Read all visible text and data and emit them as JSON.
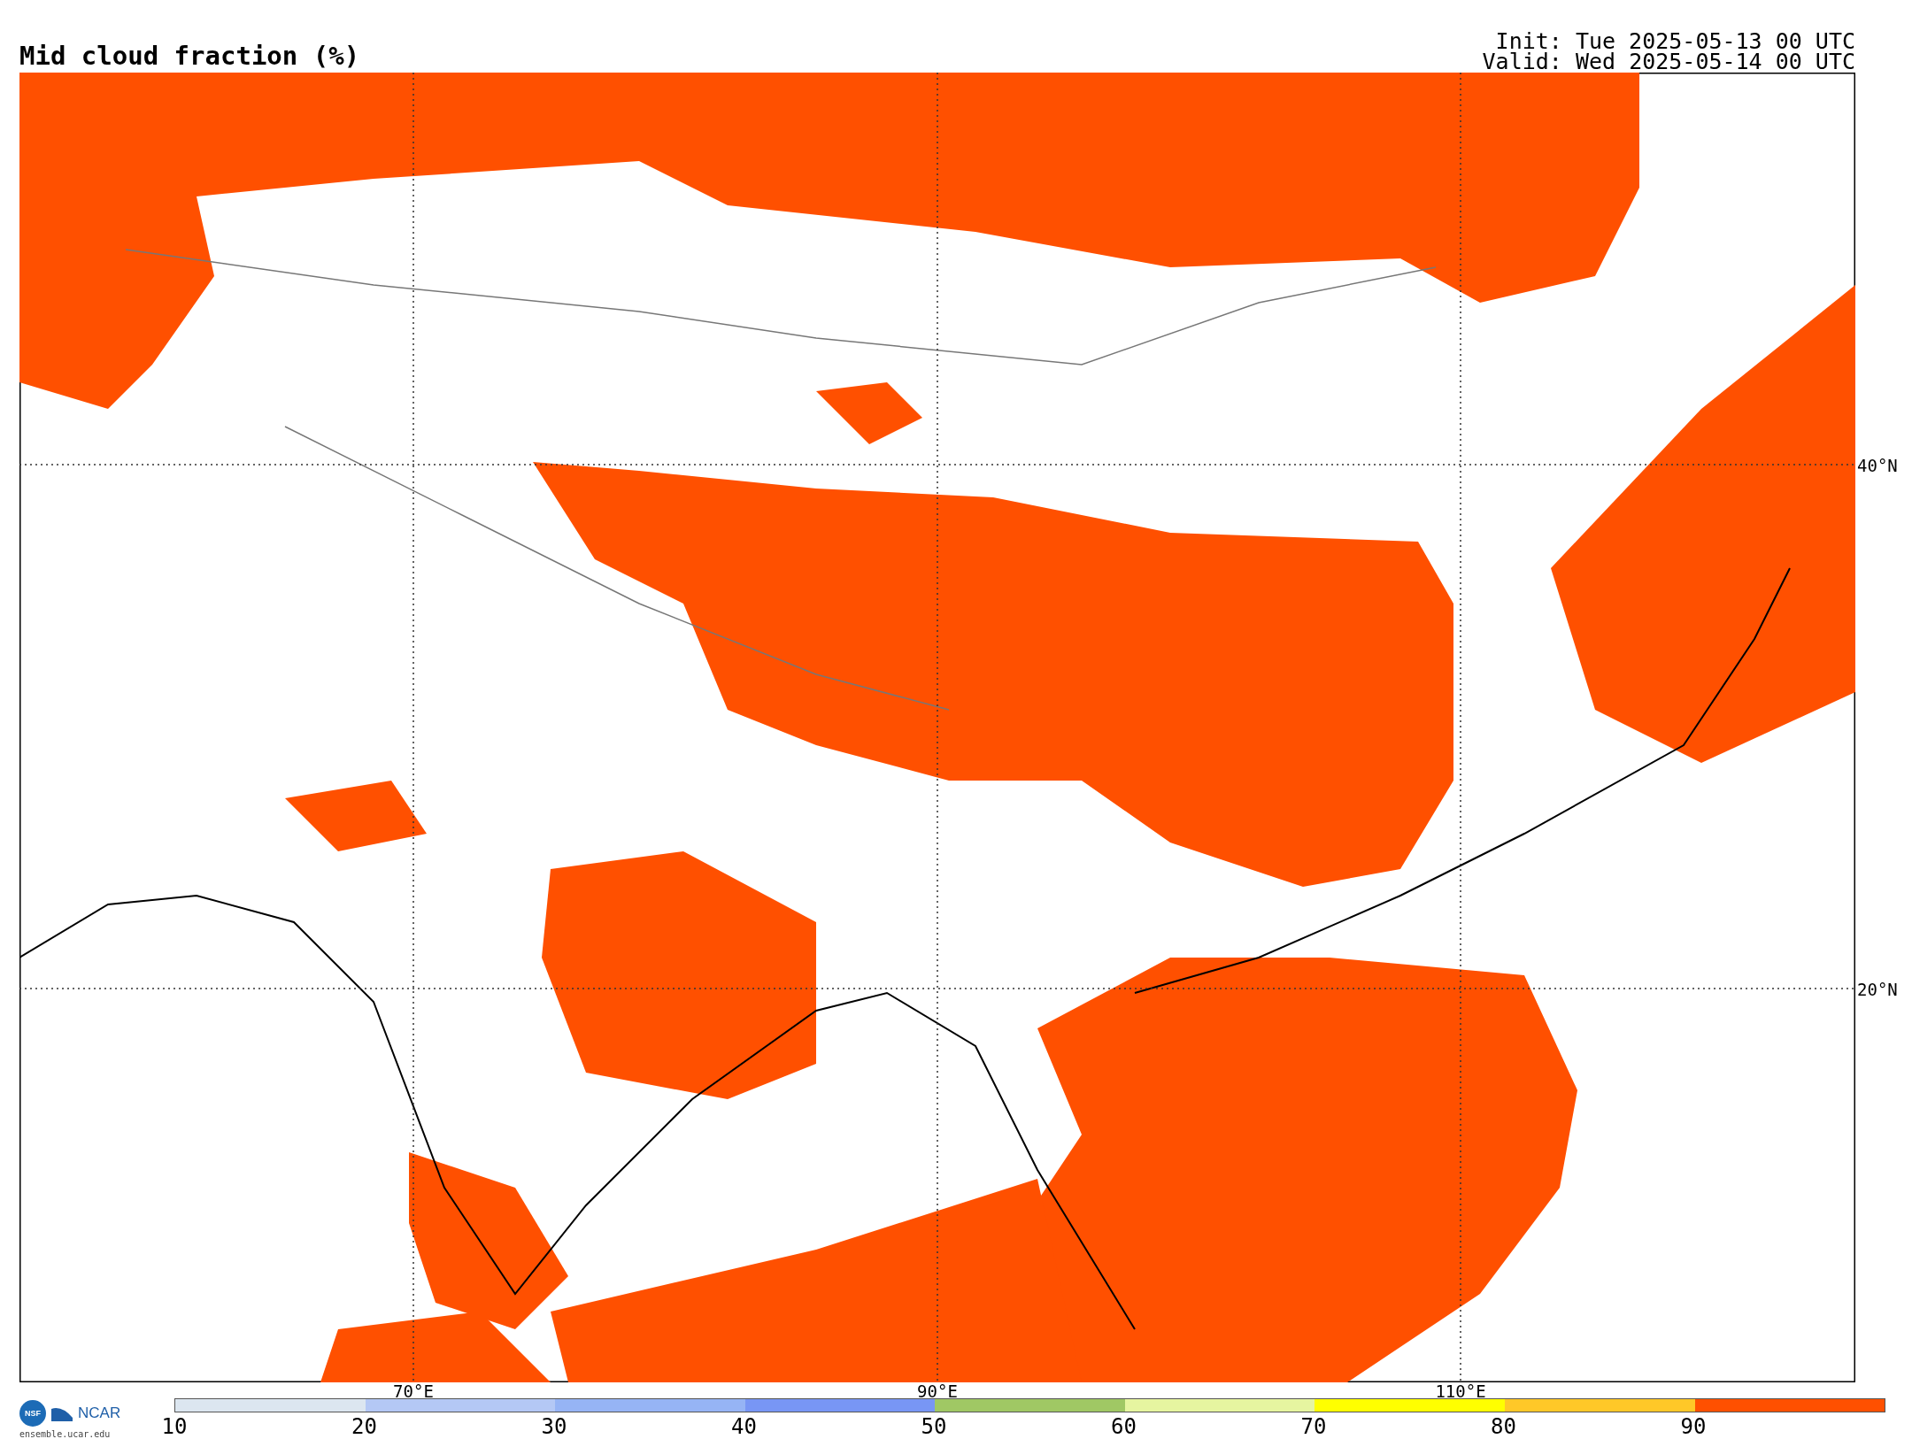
{
  "title": "Mid cloud fraction (%)",
  "init": "Init: Tue 2025-05-13 00 UTC",
  "valid": "Valid: Wed 2025-05-14 00 UTC",
  "map": {
    "longitude_labels": [
      "70°E",
      "90°E",
      "110°E"
    ],
    "latitude_labels": [
      "40°N",
      "20°N"
    ]
  },
  "logos": {
    "nsf": "NSF",
    "ncar": "NCAR",
    "site": "ensemble.ucar.edu"
  },
  "colorbar": {
    "segments": [
      {
        "color": "#dce6f0"
      },
      {
        "color": "#b4c8f5"
      },
      {
        "color": "#96b4f5"
      },
      {
        "color": "#7896f5"
      },
      {
        "color": "#a0c864"
      },
      {
        "color": "#e6f5a0"
      },
      {
        "color": "#ffff00"
      },
      {
        "color": "#ffc828"
      },
      {
        "color": "#ff5000"
      }
    ],
    "ticks": [
      "10",
      "20",
      "30",
      "40",
      "50",
      "60",
      "70",
      "80",
      "90"
    ]
  }
}
